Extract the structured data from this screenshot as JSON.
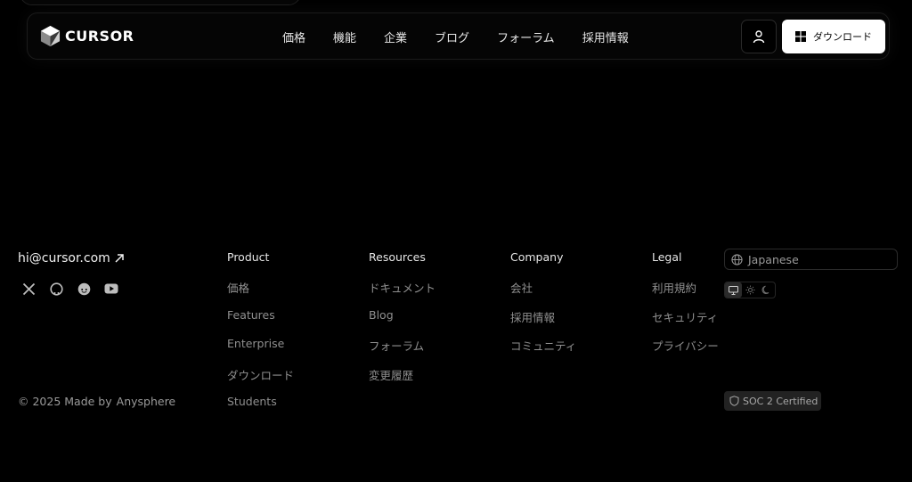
{
  "header": {
    "logo_text": "CURSOR",
    "nav": [
      "価格",
      "機能",
      "企業",
      "ブログ",
      "フォーラム",
      "採用情報"
    ],
    "download_label": "ダウンロード",
    "user_icon": "user-icon",
    "download_icon": "windows-icon"
  },
  "footer": {
    "email": "hi@cursor.com",
    "socials": [
      "x-icon",
      "github-icon",
      "reddit-icon",
      "youtube-icon"
    ],
    "copyright": "© 2025 Made by",
    "maker": "Anysphere",
    "columns": [
      {
        "title": "Product",
        "links": [
          "価格",
          "Features",
          "Enterprise",
          "ダウンロード",
          "Students"
        ]
      },
      {
        "title": "Resources",
        "links": [
          "ドキュメント",
          "Blog",
          "フォーラム",
          "変更履歴"
        ]
      },
      {
        "title": "Company",
        "links": [
          "会社",
          "採用情報",
          "コミュニティ"
        ]
      },
      {
        "title": "Legal",
        "links": [
          "利用規約",
          "セキュリティ",
          "プライバシー"
        ]
      }
    ],
    "language": "Japanese",
    "theme_options": [
      "system-icon",
      "sun-icon",
      "moon-icon"
    ],
    "theme_selected": "system",
    "soc_badge": "SOC 2 Certified"
  },
  "colors": {
    "background": "#000000",
    "download_button": "#ffffff",
    "link_muted": "#8f8f8f"
  }
}
